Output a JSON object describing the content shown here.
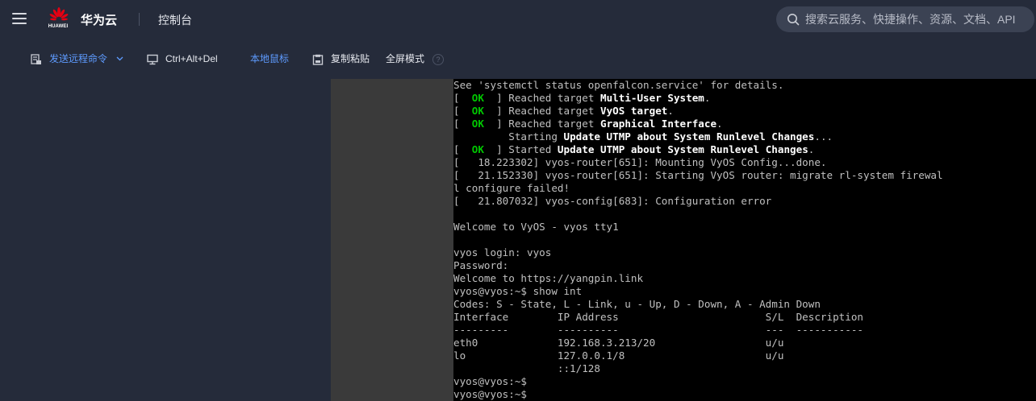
{
  "header": {
    "logo_text": "HUAWEI",
    "brand": "华为云",
    "console": "控制台",
    "search_placeholder": "搜索云服务、快捷操作、资源、文档、API",
    "brand_color": "#e60012"
  },
  "toolbar": {
    "send_command": "发送远程命令",
    "ctrl_alt_del": "Ctrl+Alt+Del",
    "local_mouse": "本地鼠标",
    "copy_paste": "复制粘贴",
    "fullscreen": "全屏模式",
    "help": "?",
    "accent_color": "#5e9bff"
  },
  "terminal": {
    "lines": [
      {
        "segments": [
          {
            "text": "See 'systemctl status openfalcon.service' for details.",
            "style": "normal"
          }
        ]
      },
      {
        "segments": [
          {
            "text": "[  ",
            "style": "normal"
          },
          {
            "text": "OK",
            "style": "ok"
          },
          {
            "text": "  ] Reached target ",
            "style": "normal"
          },
          {
            "text": "Multi-User System",
            "style": "hl"
          },
          {
            "text": ".",
            "style": "normal"
          }
        ]
      },
      {
        "segments": [
          {
            "text": "[  ",
            "style": "normal"
          },
          {
            "text": "OK",
            "style": "ok"
          },
          {
            "text": "  ] Reached target ",
            "style": "normal"
          },
          {
            "text": "VyOS target",
            "style": "hl"
          },
          {
            "text": ".",
            "style": "normal"
          }
        ]
      },
      {
        "segments": [
          {
            "text": "[  ",
            "style": "normal"
          },
          {
            "text": "OK",
            "style": "ok"
          },
          {
            "text": "  ] Reached target ",
            "style": "normal"
          },
          {
            "text": "Graphical Interface",
            "style": "hl"
          },
          {
            "text": ".",
            "style": "normal"
          }
        ]
      },
      {
        "segments": [
          {
            "text": "         Starting ",
            "style": "normal"
          },
          {
            "text": "Update UTMP about System Runlevel Changes",
            "style": "hl"
          },
          {
            "text": "...",
            "style": "normal"
          }
        ]
      },
      {
        "segments": [
          {
            "text": "[  ",
            "style": "normal"
          },
          {
            "text": "OK",
            "style": "ok"
          },
          {
            "text": "  ] Started ",
            "style": "normal"
          },
          {
            "text": "Update UTMP about System Runlevel Changes",
            "style": "hl"
          },
          {
            "text": ".",
            "style": "normal"
          }
        ]
      },
      {
        "segments": [
          {
            "text": "[   18.223302] vyos-router[651]: Mounting VyOS Config...done.",
            "style": "normal"
          }
        ]
      },
      {
        "segments": [
          {
            "text": "[   21.152330] vyos-router[651]: Starting VyOS router: migrate rl-system firewal",
            "style": "normal"
          }
        ]
      },
      {
        "segments": [
          {
            "text": "l configure failed!",
            "style": "normal"
          }
        ]
      },
      {
        "segments": [
          {
            "text": "[   21.807032] vyos-config[683]: Configuration error",
            "style": "normal"
          }
        ]
      },
      {
        "segments": [
          {
            "text": "",
            "style": "normal"
          }
        ]
      },
      {
        "segments": [
          {
            "text": "Welcome to VyOS - vyos tty1",
            "style": "normal"
          }
        ]
      },
      {
        "segments": [
          {
            "text": "",
            "style": "normal"
          }
        ]
      },
      {
        "segments": [
          {
            "text": "vyos login: vyos",
            "style": "normal"
          }
        ]
      },
      {
        "segments": [
          {
            "text": "Password:",
            "style": "normal"
          }
        ]
      },
      {
        "segments": [
          {
            "text": "Welcome to https://yangpin.link",
            "style": "normal"
          }
        ]
      },
      {
        "segments": [
          {
            "text": "vyos@vyos:~$ show int",
            "style": "normal"
          }
        ]
      },
      {
        "segments": [
          {
            "text": "Codes: S - State, L - Link, u - Up, D - Down, A - Admin Down",
            "style": "normal"
          }
        ]
      },
      {
        "segments": [
          {
            "text": "Interface        IP Address                        S/L  Description",
            "style": "normal"
          }
        ]
      },
      {
        "segments": [
          {
            "text": "---------        ----------                        ---  -----------",
            "style": "normal"
          }
        ]
      },
      {
        "segments": [
          {
            "text": "eth0             192.168.3.213/20                  u/u",
            "style": "normal"
          }
        ]
      },
      {
        "segments": [
          {
            "text": "lo               127.0.0.1/8                       u/u",
            "style": "normal"
          }
        ]
      },
      {
        "segments": [
          {
            "text": "                 ::1/128",
            "style": "normal"
          }
        ]
      },
      {
        "segments": [
          {
            "text": "vyos@vyos:~$",
            "style": "normal"
          }
        ]
      },
      {
        "segments": [
          {
            "text": "vyos@vyos:~$",
            "style": "normal"
          }
        ]
      }
    ]
  }
}
